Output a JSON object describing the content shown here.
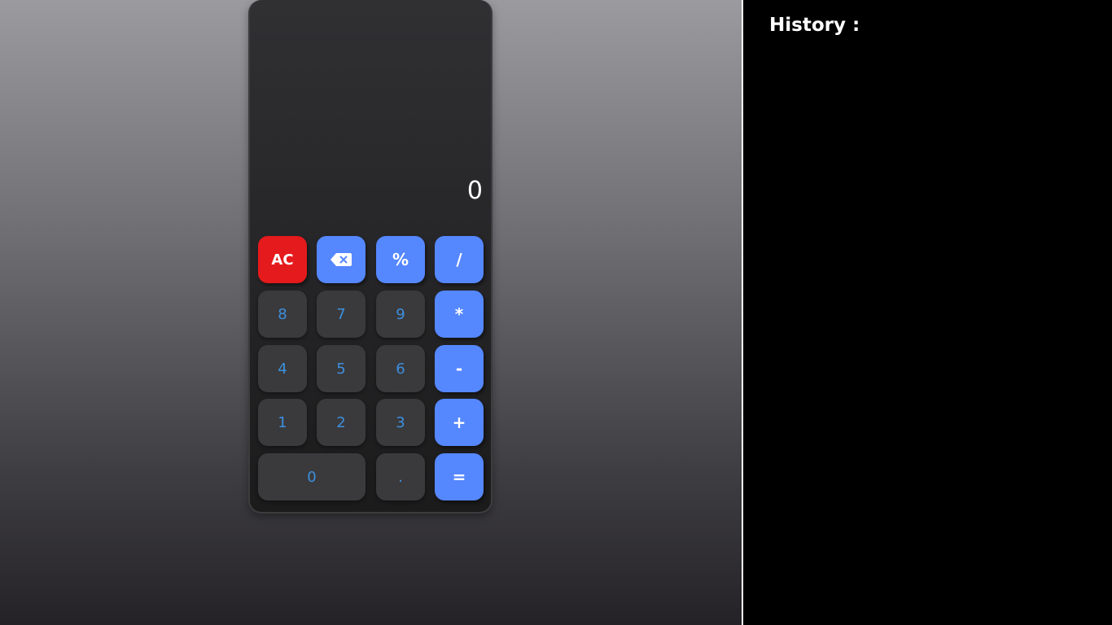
{
  "calculator": {
    "display_value": "0",
    "keys": {
      "clear": "AC",
      "backspace": "backspace-icon",
      "percent": "%",
      "divide": "/",
      "multiply": "*",
      "subtract": "-",
      "add": "+",
      "equals": "=",
      "decimal": ".",
      "zero": "0",
      "one": "1",
      "two": "2",
      "three": "3",
      "four": "4",
      "five": "5",
      "six": "6",
      "seven": "7",
      "eight": "8",
      "nine": "9"
    }
  },
  "history": {
    "title": "History :",
    "entries": []
  },
  "colors": {
    "operator_key": "#5587ff",
    "clear_key": "#e51a1c",
    "number_key": "#3a3a3c",
    "number_text": "#3d8fdd",
    "history_background": "#000000"
  }
}
